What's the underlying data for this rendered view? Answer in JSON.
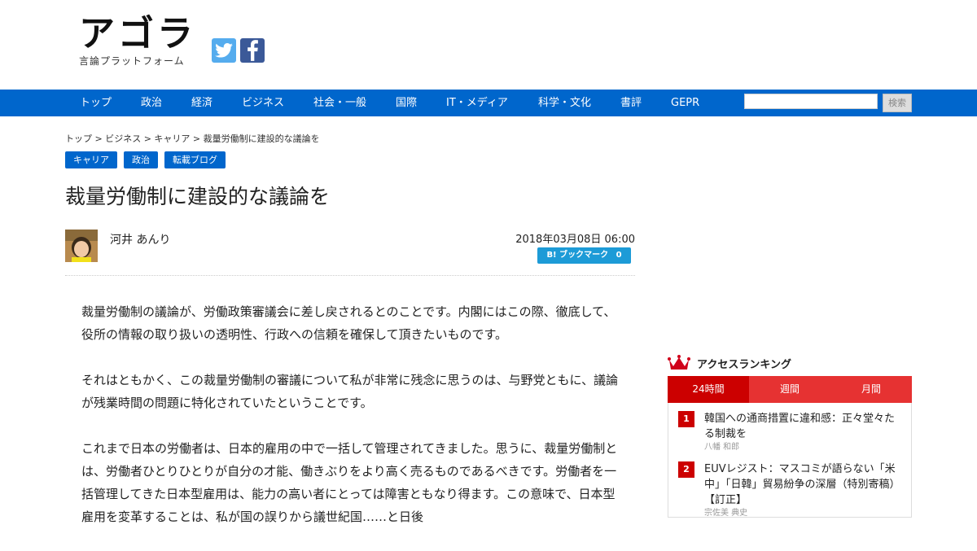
{
  "site": {
    "logo_title": "アゴラ",
    "logo_subtitle": "言論プラットフォーム",
    "social": [
      "twitter-icon",
      "facebook-icon"
    ]
  },
  "nav": {
    "items": [
      "トップ",
      "政治",
      "経済",
      "ビジネス",
      "社会・一般",
      "国際",
      "IT・メディア",
      "科学・文化",
      "書評",
      "GEPR"
    ],
    "search_button": "検索"
  },
  "breadcrumb": "トップ > ビジネス > キャリア > 裁量労働制に建設的な議論を",
  "tags": [
    "キャリア",
    "政治",
    "転載ブログ"
  ],
  "article": {
    "title": "裁量労働制に建設的な議論を",
    "author": "河井 あんり",
    "date": "2018年03月08日 06:00",
    "bookmark_label": "B! ブックマーク",
    "bookmark_count": "0",
    "paragraphs": [
      "裁量労働制の議論が、労働政策審議会に差し戻されるとのことです。内閣にはこの際、徹底して、役所の情報の取り扱いの透明性、行政への信頼を確保して頂きたいものです。",
      "それはともかく、この裁量労働制の審議について私が非常に残念に思うのは、与野党ともに、議論が残業時間の問題に特化されていたということです。",
      "これまで日本の労働者は、日本的雇用の中で一括して管理されてきました。思うに、裁量労働制とは、労働者ひとりひとりが自分の才能、働きぶりをより高く売るものであるべきです。労働者を一括管理してきた日本型雇用は、能力の高い者にとっては障害ともなり得ます。この意味で、日本型雇用を変革することは、私が国の誤りから議世紀国……と日後"
    ]
  },
  "ranking": {
    "title": "アクセスランキング",
    "tabs": [
      "24時間",
      "週間",
      "月間"
    ],
    "items": [
      {
        "rank": "1",
        "title": "韓国への通商措置に違和感：正々堂々たる制裁を",
        "author": "八幡 和郎"
      },
      {
        "rank": "2",
        "title": "EUVレジスト：マスコミが語らない「米中」「日韓」貿易紛争の深層（特別寄稿）【訂正】",
        "author": "宗佐美 典史"
      }
    ]
  },
  "colors": {
    "nav": "#0066cc",
    "ranking": "#e63232",
    "ranking_active": "#cc0000",
    "bookmark": "#1d9bd7"
  }
}
